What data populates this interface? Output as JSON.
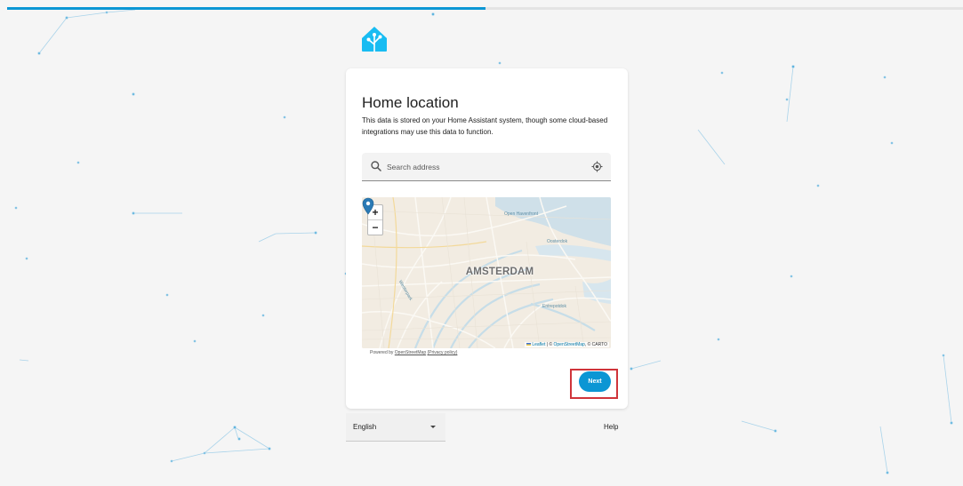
{
  "progress": {
    "fraction": 0.5
  },
  "logo": {
    "icon": "home-assistant-logo-icon",
    "color": "#18bcf2"
  },
  "card": {
    "title": "Home location",
    "description": "This data is stored on your Home Assistant system, though some cloud-based integrations may use this data to function.",
    "search": {
      "placeholder": "Search address",
      "value": "",
      "search_icon": "search-icon",
      "locate_icon": "my-location-icon"
    },
    "map": {
      "zoom_in": "+",
      "zoom_out": "−",
      "city_label": "AMSTERDAM",
      "labels": [
        "Open Havenfront",
        "Oosterdok",
        "Westerpark",
        "Entrepotdok"
      ],
      "attribution_leaflet": "Leaflet",
      "attribution_sep": "| ©",
      "attribution_osm": "OpenStreetMap",
      "attribution_carto": ", © CARTO",
      "marker_icon": "map-pin-icon"
    },
    "powered_prefix": "Powered by",
    "powered_link": "OpenStreetMap",
    "privacy_link": "(Privacy policy)",
    "next_label": "Next"
  },
  "footer": {
    "language": "English",
    "help": "Help"
  },
  "colors": {
    "accent": "#0b96d4",
    "highlight": "#d0343a"
  }
}
